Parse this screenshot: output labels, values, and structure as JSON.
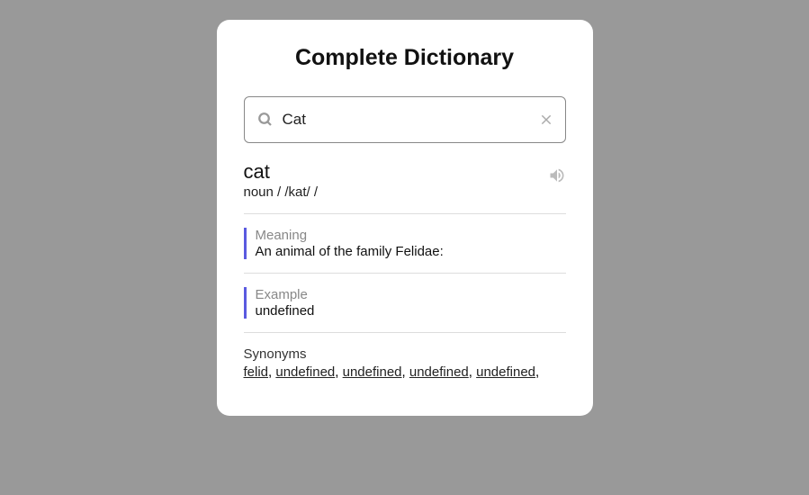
{
  "title": "Complete Dictionary",
  "search": {
    "value": "Cat"
  },
  "result": {
    "word": "cat",
    "details": "noun / /kat/ /"
  },
  "meaning": {
    "label": "Meaning",
    "value": "An animal of the family Felidae:"
  },
  "example": {
    "label": "Example",
    "value": "undefined"
  },
  "synonyms": {
    "label": "Synonyms",
    "list": [
      "felid",
      "undefined",
      "undefined",
      "undefined",
      "undefined"
    ]
  }
}
